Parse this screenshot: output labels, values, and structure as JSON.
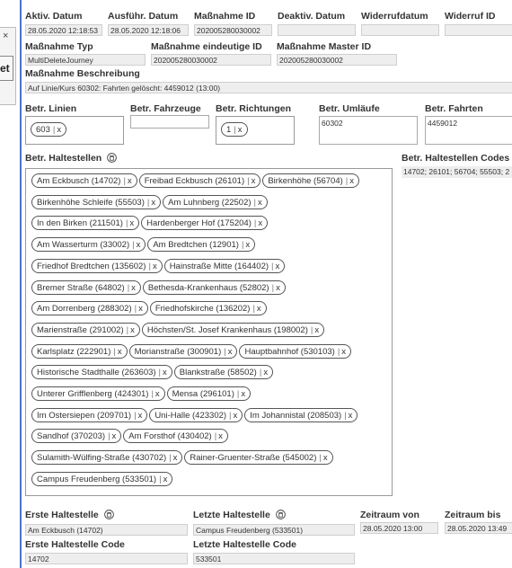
{
  "overlay": {
    "close": "×",
    "text": "et"
  },
  "header_row": {
    "aktiv_datum": {
      "label": "Aktiv. Datum",
      "value": "28.05.2020 12:18:53"
    },
    "ausfuehr_datum": {
      "label": "Ausführ. Datum",
      "value": "28.05.2020 12:18:06"
    },
    "massnahme_id": {
      "label": "Maßnahme ID",
      "value": "202005280030002"
    },
    "deaktiv_datum": {
      "label": "Deaktiv. Datum",
      "value": ""
    },
    "widerrufdatum": {
      "label": "Widerrufdatum",
      "value": ""
    },
    "widerruf_id": {
      "label": "Widerruf ID",
      "value": ""
    }
  },
  "row2": {
    "massnahme_typ": {
      "label": "Maßnahme Typ",
      "value": "MultiDeleteJourney"
    },
    "eindeutige_id": {
      "label": "Maßnahme eindeutige ID",
      "value": "202005280030002"
    },
    "master_id": {
      "label": "Maßnahme Master ID",
      "value": "202005280030002"
    }
  },
  "beschreibung": {
    "label": "Maßnahme Beschreibung",
    "value": "Auf Linie/Kurs 60302: Fahrten gelöscht: 4459012 (13:00)"
  },
  "betr": {
    "linien": {
      "label": "Betr. Linien",
      "chips": [
        "603"
      ]
    },
    "fahrzeuge": {
      "label": "Betr. Fahrzeuge",
      "value": ""
    },
    "richtungen": {
      "label": "Betr. Richtungen",
      "chips": [
        "1"
      ]
    },
    "umlaeufe": {
      "label": "Betr. Umläufe",
      "value": "60302"
    },
    "fahrten": {
      "label": "Betr. Fahrten",
      "value": "4459012"
    }
  },
  "haltestellen": {
    "label": "Betr. Haltestellen",
    "codes_label": "Betr. Haltestellen Codes",
    "codes_value": "14702; 26101; 56704; 55503; 2",
    "rows": [
      [
        "Am Eckbusch (14702)",
        "Freibad Eckbusch (26101)",
        "Birkenhöhe (56704)"
      ],
      [
        "Birkenhöhe Schleife (55503)",
        "Am Luhnberg (22502)"
      ],
      [
        "In den Birken (211501)",
        "Hardenberger Hof (175204)"
      ],
      [
        "Am Wasserturm (33002)",
        "Am Bredtchen (12901)"
      ],
      [
        "Friedhof Bredtchen (135602)",
        "Hainstraße Mitte (164402)"
      ],
      [
        "Bremer Straße (64802)",
        "Bethesda-Krankenhaus (52802)"
      ],
      [
        "Am Dorrenberg (288302)",
        "Friedhofskirche (136202)"
      ],
      [
        "Marienstraße (291002)",
        "Höchsten/St. Josef Krankenhaus (198002)"
      ],
      [
        "Karlsplatz (222901)",
        "Morianstraße (300901)",
        "Hauptbahnhof (530103)"
      ],
      [
        "Historische Stadthalle (263603)",
        "Blankstraße (58502)"
      ],
      [
        "Unterer Grifflenberg (424301)",
        "Mensa (296101)"
      ],
      [
        "Im Ostersiepen (209701)",
        "Uni-Halle (423302)",
        "Im Johannistal (208503)"
      ],
      [
        "Sandhof (370203)",
        "Am Forsthof (430402)"
      ],
      [
        "Sulamith-Wülfing-Straße (430702)",
        "Rainer-Gruenter-Straße (545002)"
      ],
      [
        "Campus Freudenberg (533501)"
      ]
    ]
  },
  "bottom": {
    "erste": {
      "label": "Erste Haltestelle",
      "value": "Am Eckbusch (14702)"
    },
    "letzte": {
      "label": "Letzte Haltestelle",
      "value": "Campus Freudenberg (533501)"
    },
    "zeitraum_von": {
      "label": "Zeitraum von",
      "value": "28.05.2020 13:00"
    },
    "zeitraum_bis": {
      "label": "Zeitraum bis",
      "value": "28.05.2020 13:49"
    },
    "erste_code": {
      "label": "Erste Haltestelle Code",
      "value": "14702"
    },
    "letzte_code": {
      "label": "Letzte Haltestelle Code",
      "value": "533501"
    }
  },
  "icons": {
    "clear": "bin-icon",
    "remove": "x"
  }
}
